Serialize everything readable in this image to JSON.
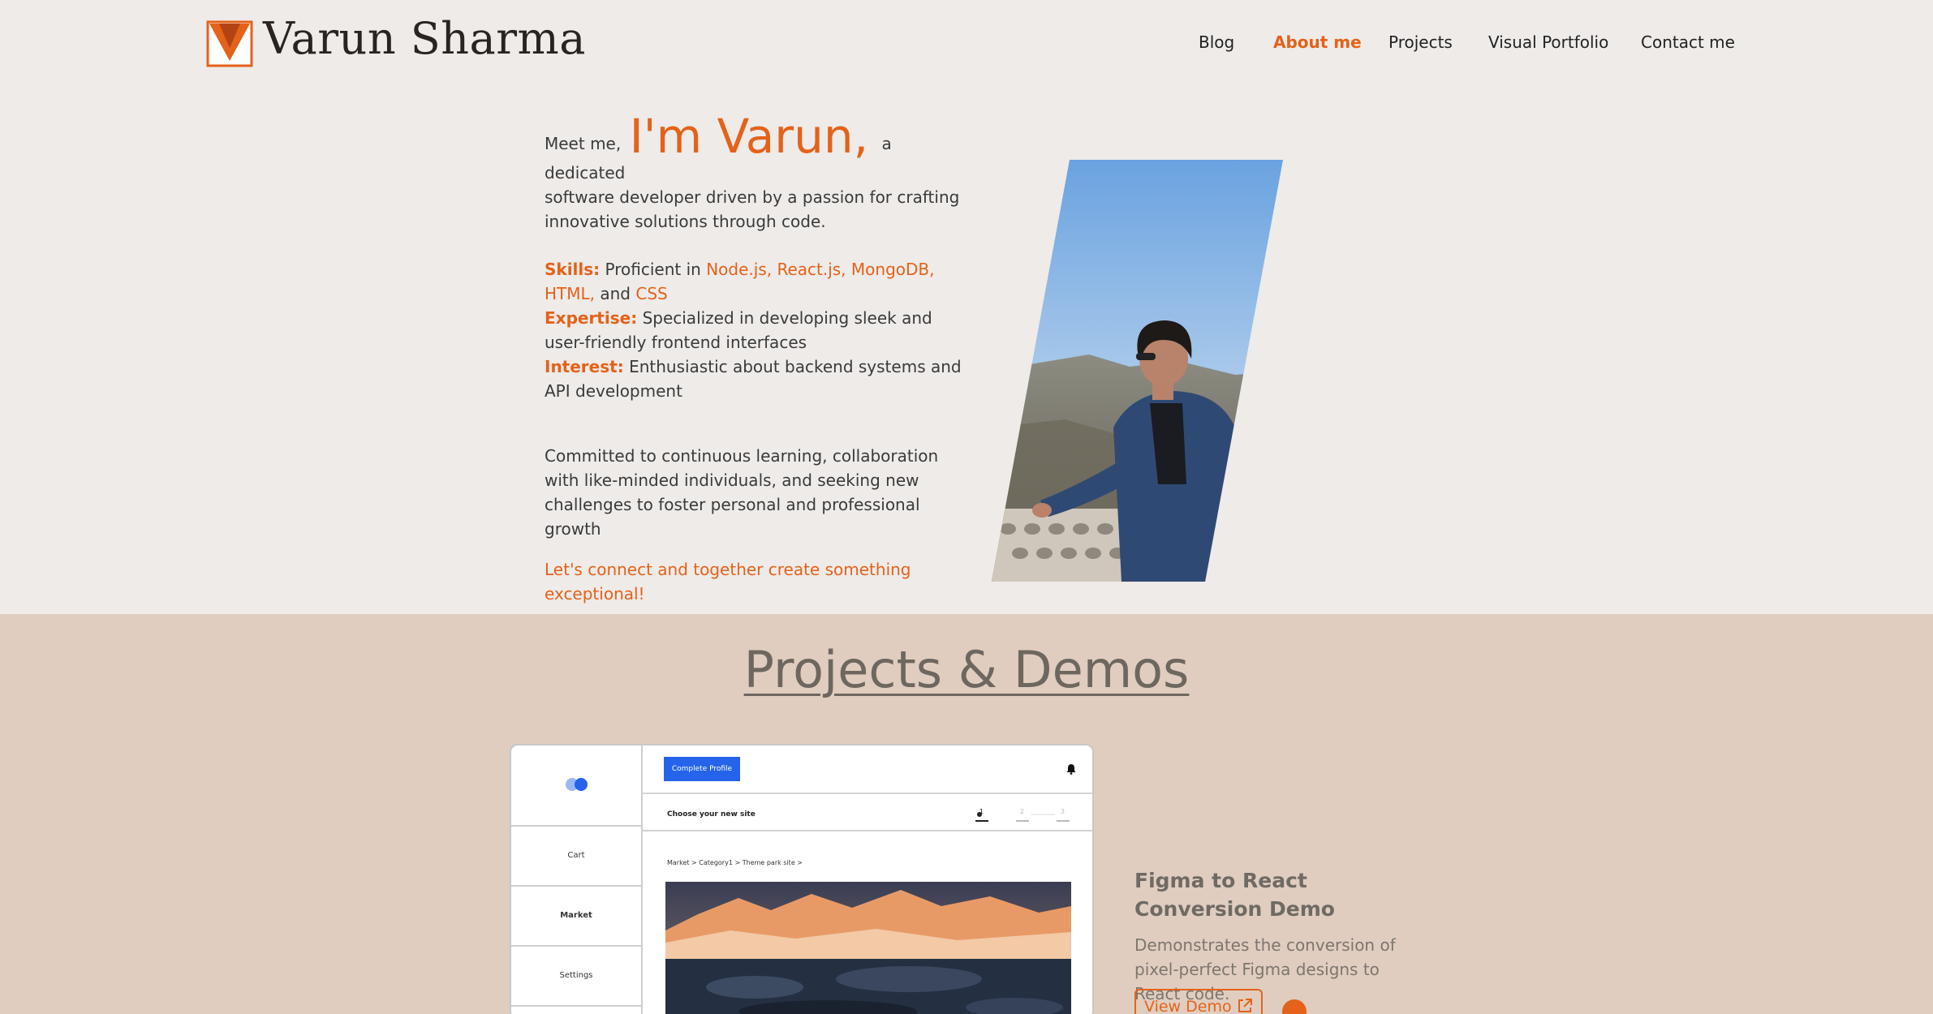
{
  "header": {
    "logo_text": "Varun Sharma",
    "nav": [
      {
        "label": "Blog",
        "active": false
      },
      {
        "label": "About me",
        "active": true
      },
      {
        "label": "Projects",
        "active": false
      },
      {
        "label": "Visual Portfolio",
        "active": false
      },
      {
        "label": "Contact me",
        "active": false
      }
    ]
  },
  "about": {
    "intro_prefix": "Meet me,",
    "intro_name": "I'm Varun,",
    "intro_rest_1": "a dedicated",
    "intro_rest_2": "software developer driven by a passion for crafting",
    "intro_rest_3": "innovative solutions through code.",
    "skills_label": "Skills:",
    "skills_prefix": "Proficient in",
    "skills_list": "Node.js, React.js, MongoDB, HTML,",
    "skills_and": "and",
    "skills_last": "CSS",
    "expertise_label": "Expertise:",
    "expertise_text": "Specialized in developing sleek and user-friendly frontend interfaces",
    "interest_label": "Interest:",
    "interest_text": "Enthusiastic about backend systems and API development",
    "commitment": "Committed to continuous learning, collaboration with like-minded individuals, and seeking new challenges to foster personal and professional growth",
    "cta": "Let's connect and together create something exceptional!"
  },
  "projects": {
    "title": "Projects & Demos",
    "mock": {
      "sidebar": [
        "Cart",
        "Market",
        "Settings"
      ],
      "complete_profile": "Complete Profile",
      "choose_site": "Choose your new site",
      "breadcrumb": "Market > Category1 > Theme park site >",
      "steps": [
        "1",
        "2",
        "3"
      ]
    },
    "card": {
      "title": "Figma to React Conversion Demo",
      "description": "Demonstrates the conversion of pixel-perfect Figma designs to React code.",
      "demo_button": "View Demo"
    }
  },
  "colors": {
    "accent": "#e4621a",
    "page_bg": "#eeebe9",
    "section_bg": "#e0cdbf"
  }
}
